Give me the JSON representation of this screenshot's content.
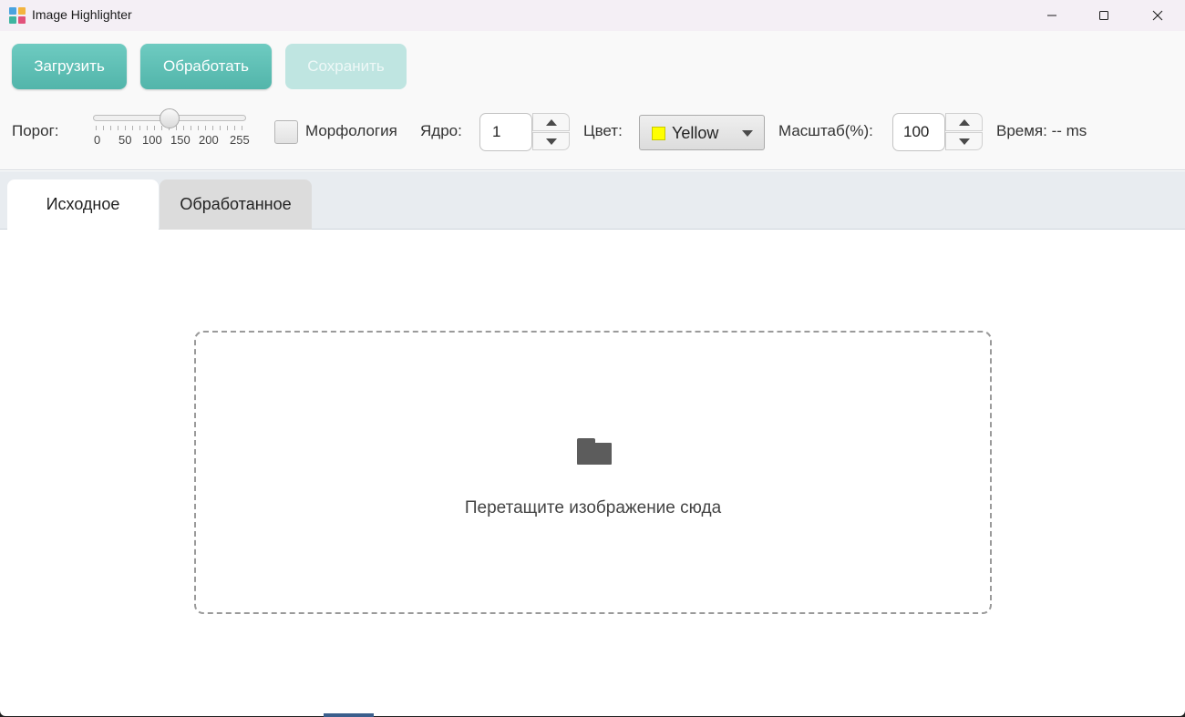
{
  "window": {
    "title": "Image Highlighter",
    "controls": [
      "minimize",
      "maximize",
      "close"
    ]
  },
  "toolbar": {
    "load_label": "Загрузить",
    "process_label": "Обработать",
    "save_label": "Сохранить",
    "save_enabled": false,
    "threshold": {
      "label": "Порог:",
      "value": 128,
      "min": 0,
      "max": 255,
      "tick_labels": [
        "0",
        "50",
        "100",
        "150",
        "200",
        "255"
      ]
    },
    "morphology": {
      "label": "Морфология",
      "checked": false
    },
    "kernel": {
      "label": "Ядро:",
      "value": "1"
    },
    "color": {
      "label": "Цвет:",
      "value": "Yellow",
      "swatch": "#ffff00"
    },
    "scale": {
      "label": "Масштаб(%):",
      "value": "100"
    },
    "time_label": "Время: -- ms"
  },
  "tabs": [
    {
      "label": "Исходное",
      "active": true
    },
    {
      "label": "Обработанное",
      "active": false
    }
  ],
  "dropzone": {
    "icon": "folder-icon",
    "text": "Перетащите изображение сюда"
  },
  "colors": {
    "accent": "#5bbdb2",
    "accent_disabled": "#bfe5e1"
  }
}
